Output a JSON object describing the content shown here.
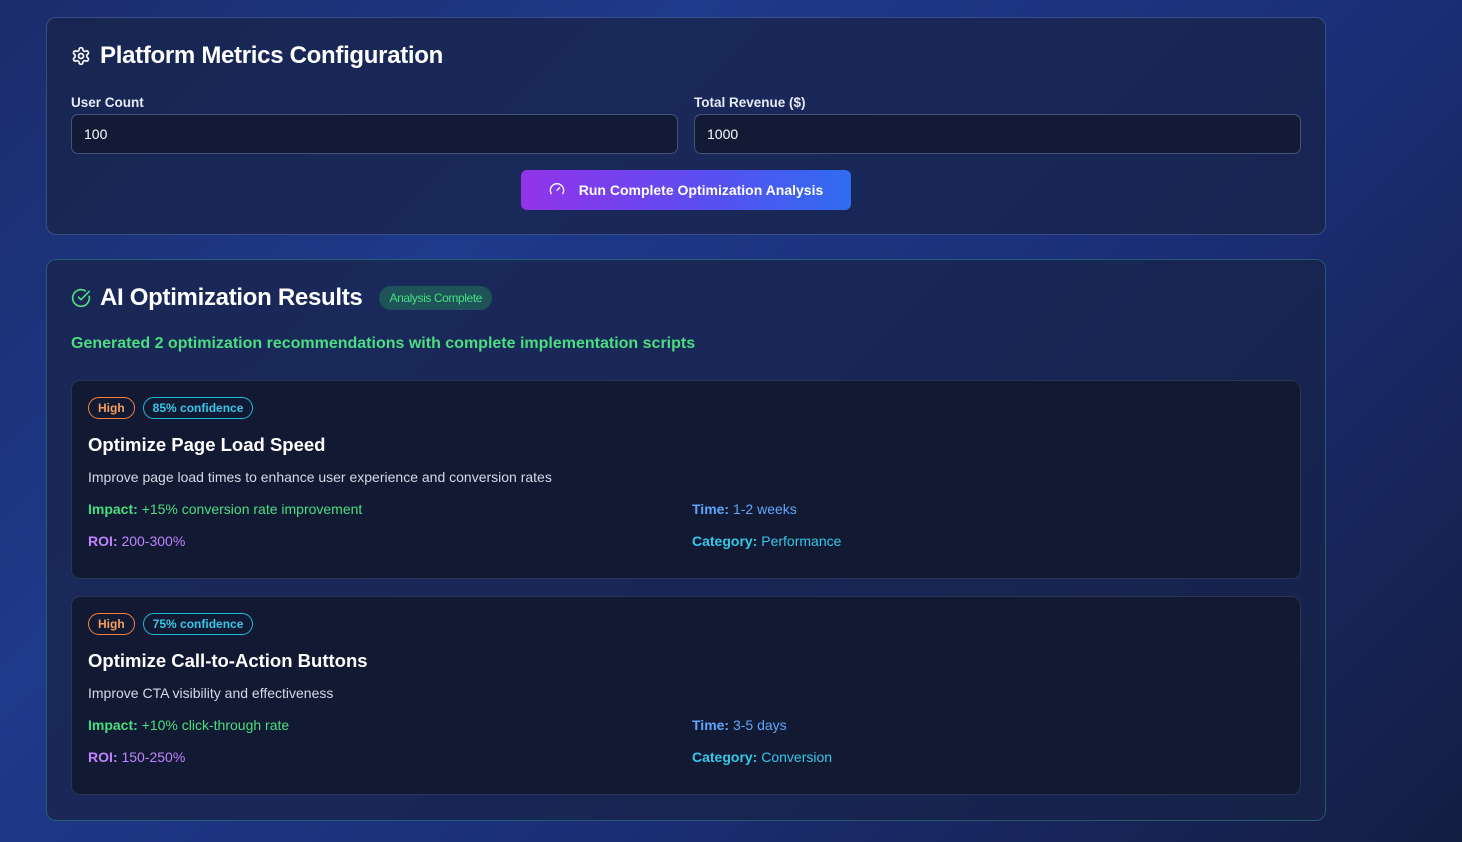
{
  "config": {
    "title": "Platform Metrics Configuration",
    "title_icon": "gear-icon",
    "user_count_label": "User Count",
    "user_count_value": "100",
    "revenue_label": "Total Revenue ($)",
    "revenue_value": "1000",
    "run_button_label": "Run Complete Optimization Analysis",
    "run_button_icon": "gauge-icon"
  },
  "results": {
    "title": "AI Optimization Results",
    "title_icon": "check-circle-icon",
    "status_badge": "Analysis Complete",
    "summary": "Generated 2 optimization recommendations with complete implementation scripts",
    "recommendations": [
      {
        "priority": "High",
        "confidence": "85% confidence",
        "title": "Optimize Page Load Speed",
        "description": "Improve page load times to enhance user experience and conversion rates",
        "impact_label": "Impact:",
        "impact": "+15% conversion rate improvement",
        "roi_label": "ROI:",
        "roi": "200-300%",
        "time_label": "Time:",
        "time": "1-2 weeks",
        "category_label": "Category:",
        "category": "Performance"
      },
      {
        "priority": "High",
        "confidence": "75% confidence",
        "title": "Optimize Call-to-Action Buttons",
        "description": "Improve CTA visibility and effectiveness",
        "impact_label": "Impact:",
        "impact": "+10% click-through rate",
        "roi_label": "ROI:",
        "roi": "150-250%",
        "time_label": "Time:",
        "time": "3-5 days",
        "category_label": "Category:",
        "category": "Conversion"
      }
    ]
  },
  "colors": {
    "accent_green": "#4ade80",
    "accent_purple": "#c084fc",
    "accent_blue": "#60a5fa",
    "accent_cyan": "#38c6e8",
    "priority_orange": "#f59e5b"
  }
}
